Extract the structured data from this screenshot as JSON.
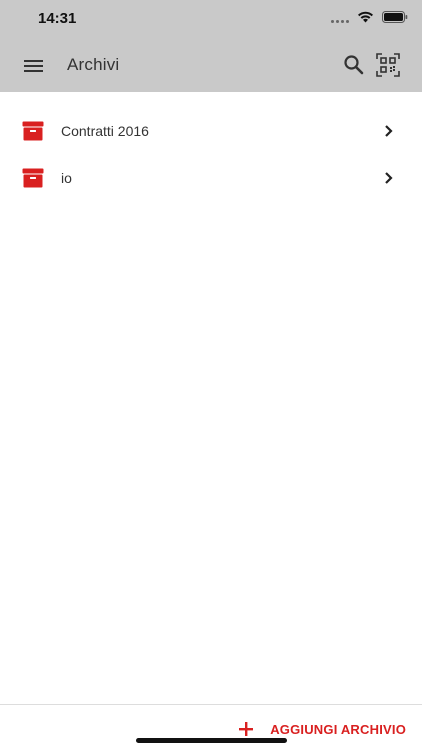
{
  "status": {
    "time": "14:31",
    "icons": [
      "signal-icon",
      "wifi-icon",
      "battery-icon"
    ]
  },
  "appbar": {
    "title": "Archivi",
    "left_icon": "menu-icon",
    "right_icons": [
      "search-icon",
      "qr-code-icon"
    ]
  },
  "archives": [
    {
      "label": "Contratti 2016",
      "icon": "archive-box-icon"
    },
    {
      "label": "io",
      "icon": "archive-box-icon"
    }
  ],
  "bottom": {
    "add_label": "AGGIUNGI ARCHIVIO",
    "add_icon": "plus-icon"
  },
  "colors": {
    "accent": "#d92020",
    "appbar_bg": "#c9c9c9",
    "text": "#333333"
  }
}
